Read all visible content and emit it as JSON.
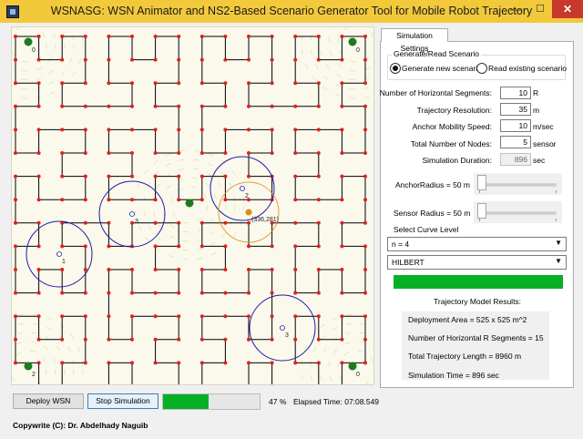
{
  "window": {
    "title": "WSNASG: WSN Animator and NS2-Based Scenario Generator Tool for Mobile Robot Trajectory",
    "minimize": "—",
    "maximize": "☐",
    "close": "✕"
  },
  "canvas": {
    "node_labels": [
      "0",
      "0",
      "2",
      "3",
      "1",
      "3",
      "2",
      "0"
    ],
    "robot_coord": "(336,281)",
    "colors": {
      "path": "#000000",
      "anchor_points": "#e0201b",
      "sensor_nodes": "#1e7a1e",
      "range_circle": "#1d1daa",
      "robot": "#d98c1a"
    }
  },
  "controls": {
    "deploy_button": "Deploy WSN",
    "stop_button": "Stop Simulation",
    "progress_percent": 47,
    "progress_text": "47 %",
    "elapsed": "Elapsed Time: 07:08.549"
  },
  "footer": {
    "copyright": "Copywrite (C): Dr. Abdelhady Naguib"
  },
  "settings": {
    "tab": "Simulation Settings",
    "group_label": "Generate/Read Scenario",
    "radio_new": "Generate new scenario",
    "radio_existing": "Read existing scenario",
    "fields": [
      {
        "label": "Number of Horizontal Segments:",
        "value": "10",
        "unit": "R"
      },
      {
        "label": "Trajectory Resolution:",
        "value": "35",
        "unit": "m"
      },
      {
        "label": "Anchor Mobility Speed:",
        "value": "10",
        "unit": "m/sec"
      },
      {
        "label": "Total Number of Nodes:",
        "value": "5",
        "unit": "sensor"
      },
      {
        "label": "Simulation Duration:",
        "value": "896",
        "unit": "sec"
      }
    ],
    "anchor_radius_label": "AnchorRadius =  50   m",
    "sensor_radius_label": "Sensor Radius =  50   m",
    "curve_level_label": "Select Curve Level",
    "curve_level": "n = 4",
    "curve_type": "HILBERT",
    "results_title": "Trajectory Model Results:",
    "results": [
      "Deployment Area = 525 x 525  m^2",
      "Number of Horizontal R Segments = 15",
      "Total Trajectory Length = 8960 m",
      "Simulation Time = 896 sec"
    ]
  }
}
